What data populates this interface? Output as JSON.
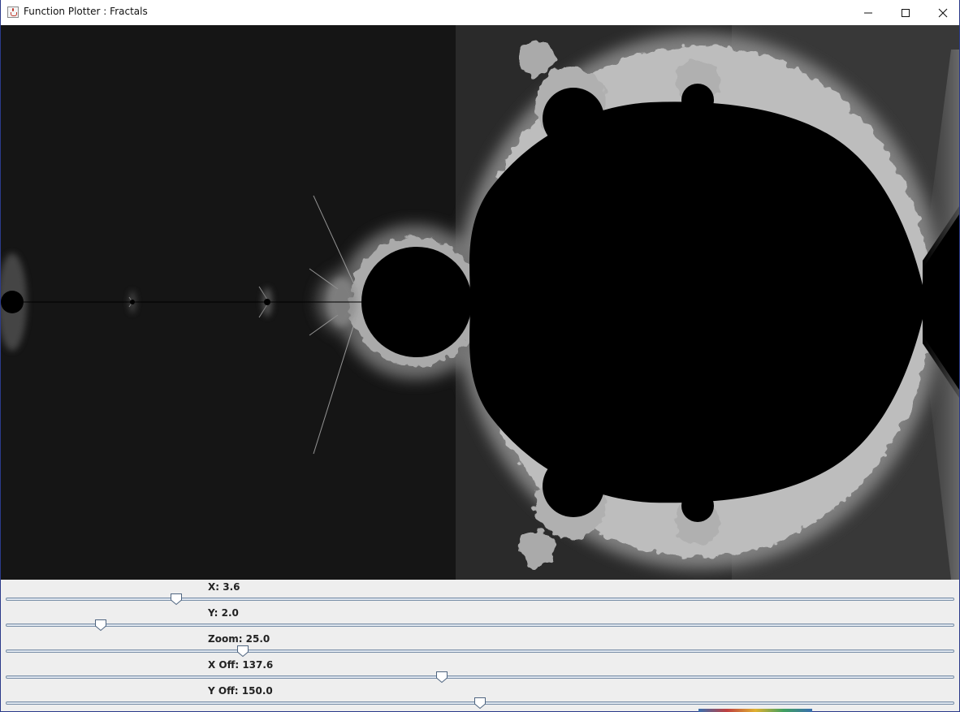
{
  "window": {
    "title": "Function Plotter : Fractals",
    "icon": "java-cup-icon",
    "controls": [
      "minimize-icon",
      "maximize-icon",
      "close-icon"
    ]
  },
  "canvas": {
    "content": "mandelbrot-set",
    "background_color": "#151515",
    "set_color": "#000000",
    "edge_color": "#bdbdbd"
  },
  "sliders": [
    {
      "name": "x",
      "label": "X: 3.6",
      "fraction": 0.18
    },
    {
      "name": "y",
      "label": "Y: 2.0",
      "fraction": 0.1
    },
    {
      "name": "zoom",
      "label": "Zoom: 25.0",
      "fraction": 0.25
    },
    {
      "name": "x-off",
      "label": "X Off: 137.6",
      "fraction": 0.46
    },
    {
      "name": "y-off",
      "label": "Y Off: 150.0",
      "fraction": 0.5
    }
  ],
  "colors": {
    "window_border": "#2b3a8a",
    "track_border": "#7a8fa8",
    "thumb_border": "#4f6580"
  }
}
